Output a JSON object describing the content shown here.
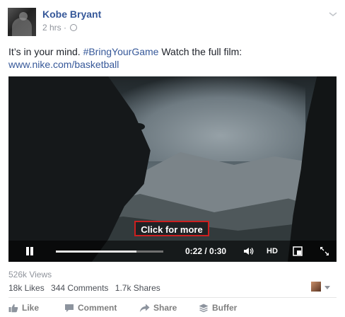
{
  "post": {
    "author": "Kobe Bryant",
    "time": "2 hrs",
    "separator": "·",
    "text_lead": "It’s in your mind. ",
    "hashtag": "#BringYourGame",
    "text_trail": " Watch the full film:",
    "link": "www.nike.com/basketball"
  },
  "video": {
    "cta": "Click for more",
    "time_label": "0:22 / 0:30",
    "progress": 0.75,
    "hd_label": "HD",
    "accent_color": "#cc1f1f"
  },
  "stats": {
    "views": "526k Views",
    "likes": "18k Likes",
    "comments": "344 Comments",
    "shares": "1.7k Shares"
  },
  "actions": {
    "like": "Like",
    "comment": "Comment",
    "share": "Share",
    "buffer": "Buffer"
  },
  "colors": {
    "link": "#365899",
    "muted": "#90949c"
  }
}
